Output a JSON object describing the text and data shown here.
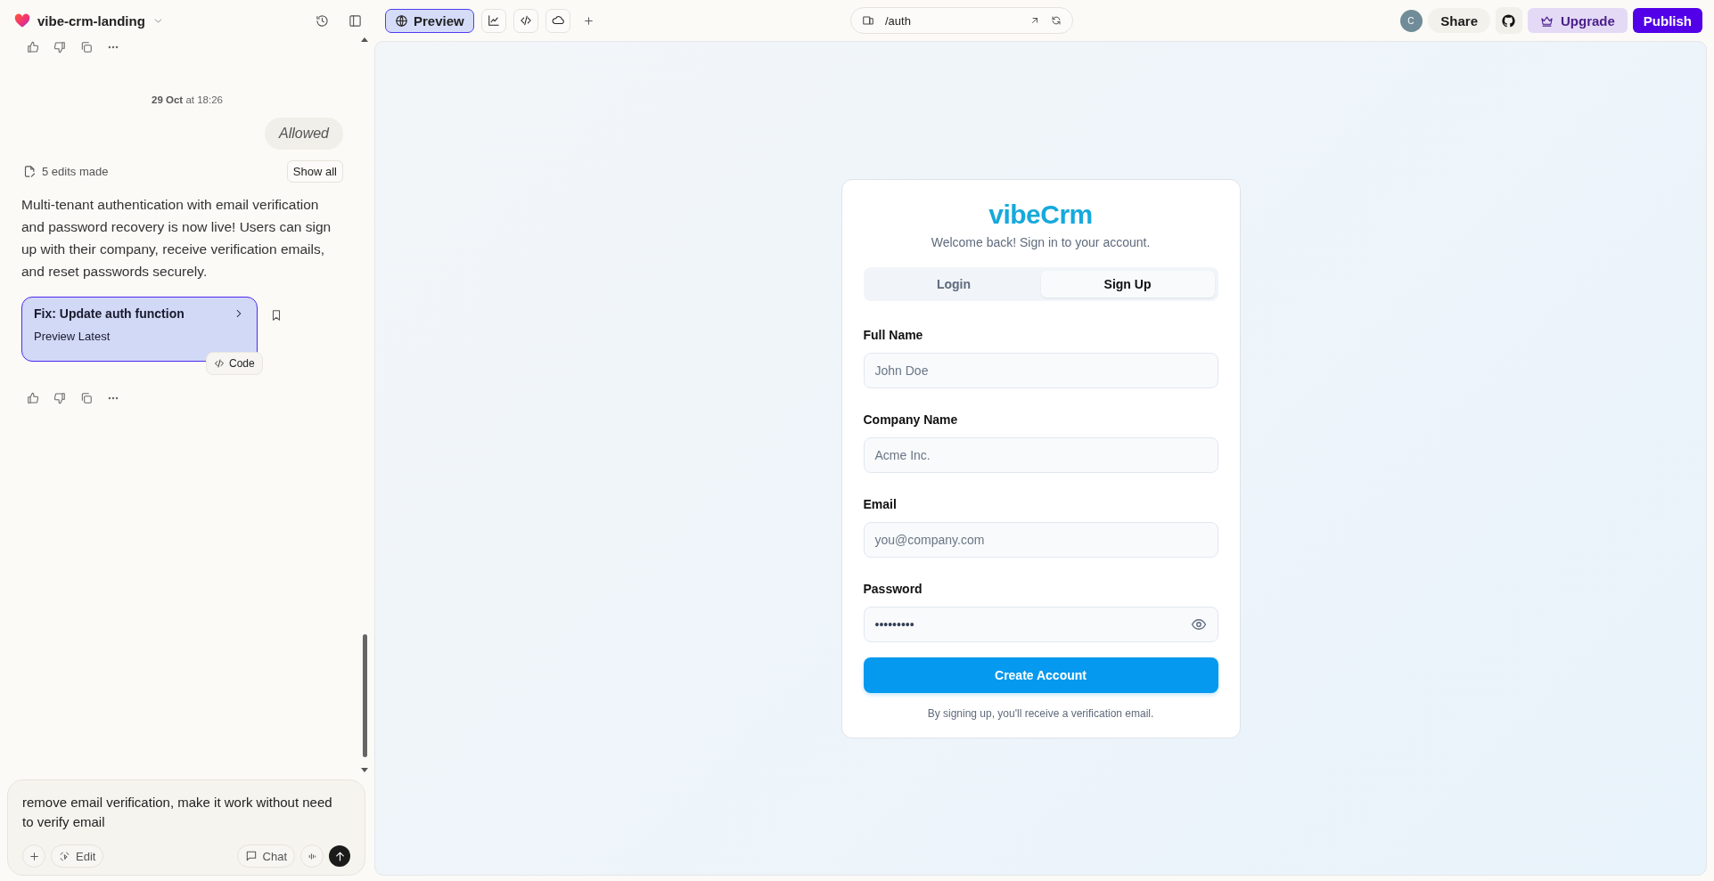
{
  "project": {
    "name": "vibe-crm-landing"
  },
  "chat": {
    "timestamp": "**29 Oct** at 18:26",
    "status_bubble": "Allowed",
    "edits": {
      "label": "5 edits made",
      "button": "Show all"
    },
    "message": "Multi-tenant authentication with email verification and password recovery is now live! Users can sign up with their company, receive verification emails, and reset passwords securely.",
    "version_card": {
      "title": "Fix: Update auth function",
      "subtitle": "Preview Latest",
      "code_button": "Code"
    }
  },
  "composer": {
    "value": "remove email verification, make it work without need to verify email",
    "edit_button": "Edit",
    "chat_button": "Chat"
  },
  "toolbar": {
    "view_tabs": [
      {
        "kind": "preview",
        "label": "Preview",
        "selected": true
      },
      {
        "kind": "analytics",
        "selected": false
      },
      {
        "kind": "code",
        "selected": false
      },
      {
        "kind": "cloud",
        "selected": false
      }
    ],
    "url": "/auth",
    "avatar_initial": "C",
    "share": "Share",
    "upgrade": "Upgrade",
    "publish": "Publish"
  },
  "auth_card": {
    "logo": "vibeCrm",
    "subtitle": "Welcome back! Sign in to your account.",
    "tabs": [
      {
        "label": "Login",
        "selected": false
      },
      {
        "label": "Sign Up",
        "selected": true
      }
    ],
    "fields": [
      {
        "kind": "text",
        "label": "Full Name",
        "placeholder": "John Doe"
      },
      {
        "kind": "text",
        "label": "Company Name",
        "placeholder": "Acme Inc."
      },
      {
        "kind": "text",
        "label": "Email",
        "placeholder": "you@company.com"
      },
      {
        "kind": "password",
        "label": "Password",
        "value": "•••••••••"
      }
    ],
    "submit": "Create Account",
    "note": "By signing up, you'll receive a verification email."
  }
}
